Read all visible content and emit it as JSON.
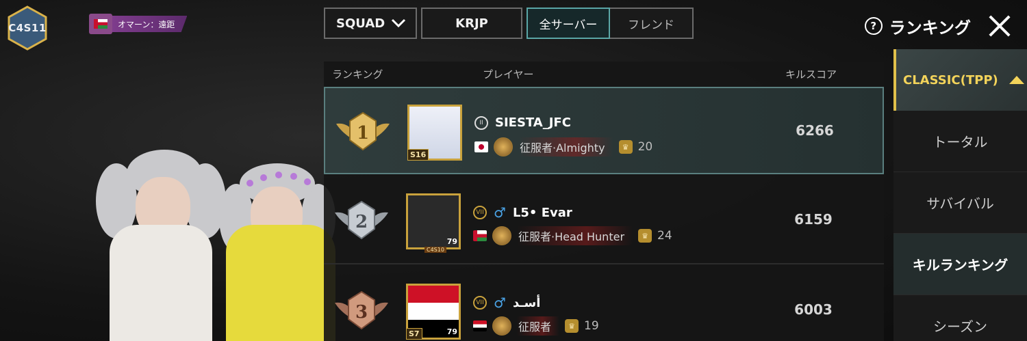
{
  "season_badge": "C4S11",
  "region_tag": "オマーン：遠距",
  "filters": {
    "mode": "SQUAD",
    "region": "KRJP",
    "server_tabs": [
      "全サーバー",
      "フレンド"
    ],
    "active_server_tab": "全サーバー"
  },
  "header": {
    "help_icon": "?",
    "title": "ランキング"
  },
  "columns": {
    "rank": "ランキング",
    "player": "プレイヤー",
    "score": "キルスコア"
  },
  "rows": [
    {
      "rank": "1",
      "name": "SIESTA_JFC",
      "tier": "S16",
      "level": "",
      "title": "征服者·Almighty",
      "tier_number": "20",
      "score": "6266",
      "flag_colors": [
        "#ffffff",
        "#bc002d"
      ]
    },
    {
      "rank": "2",
      "name": "L5• Evar",
      "tier": "",
      "level": "79",
      "frame_tag": "C4S10",
      "title": "征服者·Head Hunter",
      "tier_number": "24",
      "score": "6159",
      "flag_colors": [
        "#ffffff",
        "#c8102e"
      ]
    },
    {
      "rank": "3",
      "name": "أسـد",
      "tier": "S7",
      "level": "79",
      "title": "征服者",
      "tier_number": "19",
      "score": "6003",
      "flag_colors": [
        "#ce1126",
        "#000000"
      ]
    }
  ],
  "sidebar": {
    "category": "CLASSIC(TPP)",
    "items": [
      "トータル",
      "サバイバル",
      "キルランキング",
      "シーズン"
    ],
    "active": "キルランキング"
  },
  "colors": {
    "accent_teal": "#5aa6a6",
    "gold": "#c9a23c",
    "category_yellow": "#f3d35a"
  }
}
